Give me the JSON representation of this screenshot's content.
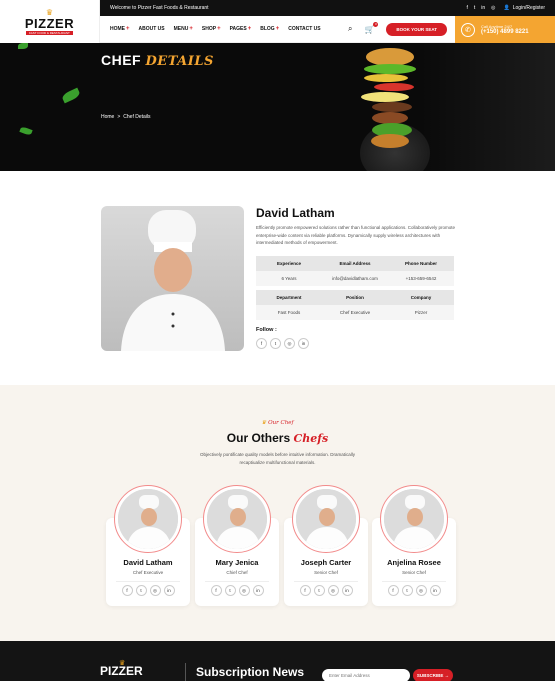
{
  "topbar": {
    "welcome": "Welcome to Pizzer Fast Foods & Restaurant",
    "social": [
      "f",
      "t",
      "in",
      "◎"
    ],
    "login": "Login/Register"
  },
  "logo": {
    "text": "PIZZER",
    "tagline": "FAST FOOD & RESTAURANT"
  },
  "nav": {
    "items": [
      {
        "label": "HOME",
        "has_sub": true
      },
      {
        "label": "ABOUT US",
        "has_sub": false
      },
      {
        "label": "MENU",
        "has_sub": true
      },
      {
        "label": "SHOP",
        "has_sub": true
      },
      {
        "label": "PAGES",
        "has_sub": true
      },
      {
        "label": "BLOG",
        "has_sub": true
      },
      {
        "label": "CONTACT US",
        "has_sub": false
      }
    ],
    "cart_count": "0",
    "book_button": "BOOK YOUR SEAT"
  },
  "call": {
    "label": "Call Anytime 24/7",
    "phone": "(+150) 4899 8221"
  },
  "hero": {
    "title_main": "CHEF",
    "title_accent": "DETAILS",
    "breadcrumb": [
      "Home",
      ">",
      "Chef Details"
    ]
  },
  "chef": {
    "name": "David Latham",
    "bio": "Efficiently promote empowered solutions rather than functional applications. Collaboratively promote enterprise-wide content via reliable platforms. Dynamically supply wireless architectures with intermediated methods of empowerment.",
    "table1": {
      "headers": [
        "Experience",
        "Email Address",
        "Phone Number"
      ],
      "values": [
        "6 Years",
        "info@davidlatham.com",
        "+153-659-6542"
      ]
    },
    "table2": {
      "headers": [
        "Department",
        "Position",
        "Company"
      ],
      "values": [
        "Fast Foods",
        "Chef Executive",
        "Pizzer"
      ]
    },
    "follow_label": "Follow :",
    "follow_icons": [
      "f",
      "t",
      "◎",
      "in"
    ]
  },
  "others": {
    "subtag": "Our Chef",
    "title_main": "Our Others",
    "title_accent": "Chefs",
    "description": "Objectively pontificate quality models before intuitive information. Dramatically recaptiualize multifunctional materials.",
    "chefs": [
      {
        "name": "David Latham",
        "role": "Chef Executive"
      },
      {
        "name": "Mary Jenica",
        "role": "Chief Chef"
      },
      {
        "name": "Joseph Carter",
        "role": "Senior Chef"
      },
      {
        "name": "Anjelina Rosee",
        "role": "Senior Chef"
      }
    ],
    "card_social": [
      "f",
      "t",
      "◎",
      "in"
    ]
  },
  "footer": {
    "logo": "PIZZER",
    "subscription_title": "Subscription News",
    "email_placeholder": "Enter Email Address",
    "subscribe_button": "SUBSCRIBE →"
  },
  "colors": {
    "accent_red": "#d61f26",
    "accent_orange": "#f4a531",
    "dark": "#0a0a0a",
    "cream": "#f8f4ee"
  }
}
